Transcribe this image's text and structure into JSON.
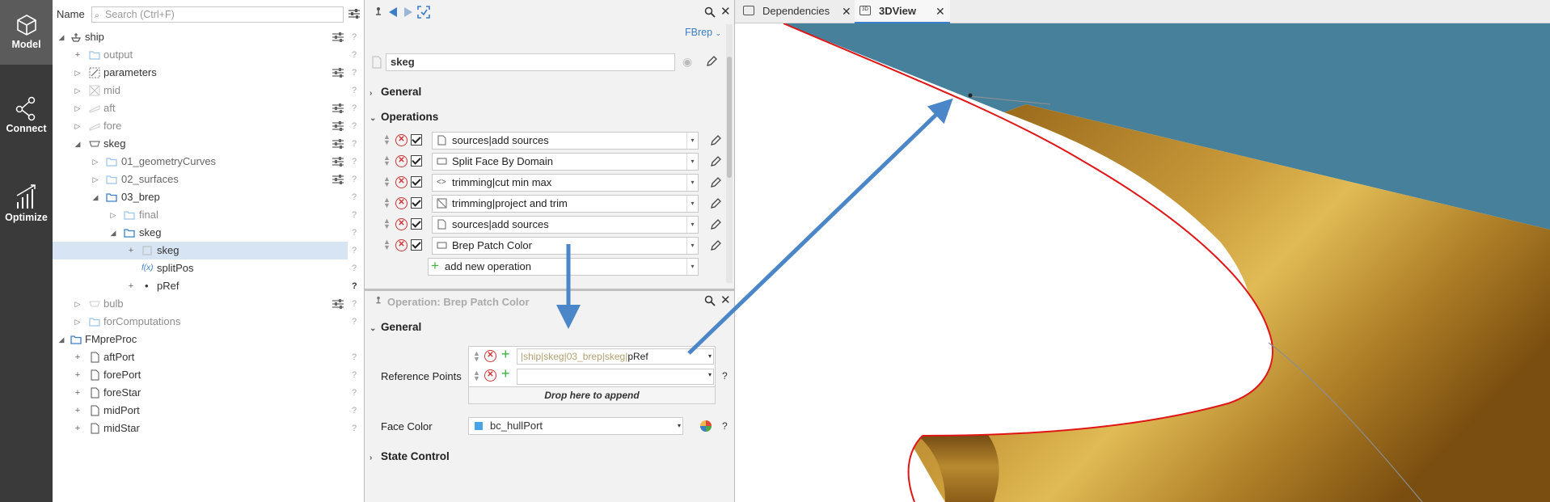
{
  "sidebar": {
    "items": [
      {
        "label": "Model",
        "icon": "cube-icon"
      },
      {
        "label": "Connect",
        "icon": "network-icon"
      },
      {
        "label": "Optimize",
        "icon": "chart-icon"
      }
    ]
  },
  "tree": {
    "name_label": "Name",
    "search_placeholder": "Search (Ctrl+F)",
    "rows": [
      {
        "label": "ship"
      },
      {
        "label": "output"
      },
      {
        "label": "parameters"
      },
      {
        "label": "mid"
      },
      {
        "label": "aft"
      },
      {
        "label": "fore"
      },
      {
        "label": "skeg"
      },
      {
        "label": "01_geometryCurves"
      },
      {
        "label": "02_surfaces"
      },
      {
        "label": "03_brep"
      },
      {
        "label": "final"
      },
      {
        "label": "skeg"
      },
      {
        "label": "skeg"
      },
      {
        "label": "splitPos"
      },
      {
        "label": "pRef"
      },
      {
        "label": "bulb"
      },
      {
        "label": "forComputations"
      },
      {
        "label": "FMpreProc"
      },
      {
        "label": "aftPort"
      },
      {
        "label": "forePort"
      },
      {
        "label": "foreStar"
      },
      {
        "label": "midPort"
      },
      {
        "label": "midStar"
      }
    ],
    "question_mark": "?",
    "fx_label": "f(x)"
  },
  "ops_panel": {
    "type_label": "FBrep",
    "object_name": "skeg",
    "general_label": "General",
    "operations_label": "Operations",
    "operations": [
      {
        "label": "sources|add sources"
      },
      {
        "label": "Split Face By Domain"
      },
      {
        "label": "trimming|cut min max"
      },
      {
        "label": "trimming|project and trim"
      },
      {
        "label": "sources|add sources"
      },
      {
        "label": "Brep Patch Color"
      }
    ],
    "add_operation_label": "add new operation"
  },
  "detail_panel": {
    "title": "Operation: Brep Patch Color",
    "general_label": "General",
    "reference_points_label": "Reference Points",
    "reference_path": "|ship|skeg|03_brep|skeg|",
    "reference_value": "pRef",
    "drop_label": "Drop here to append",
    "face_color_label": "Face Color",
    "face_color_value": "bc_hullPort",
    "face_color_swatch": "#4aa3e8",
    "state_control_label": "State Control",
    "question_mark": "?"
  },
  "tabs": [
    {
      "label": "Dependencies",
      "active": false
    },
    {
      "label": "3DView",
      "active": true
    }
  ],
  "colors": {
    "accent": "#3a7dc9",
    "annotation_arrow": "#4a86c8",
    "hull_top": "#46809b",
    "hull_gold": "#b98a2e",
    "edge_red": "#e01515"
  }
}
